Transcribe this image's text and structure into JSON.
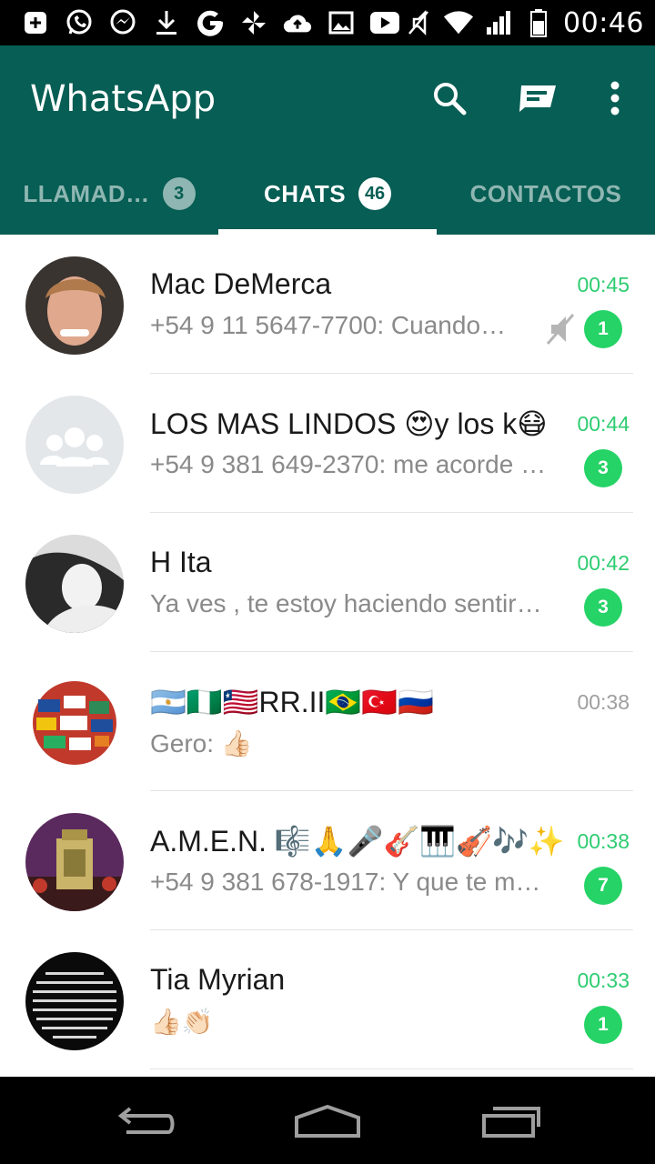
{
  "status_bar": {
    "time": "00:46",
    "left_icons": [
      "add-box-icon",
      "whatsapp-icon",
      "messenger-icon",
      "download-icon",
      "google-icon",
      "pinwheel-icon",
      "cloud-upload-icon",
      "image-icon",
      "youtube-icon"
    ],
    "right_icons": [
      "mute-icon",
      "wifi-icon",
      "signal-icon",
      "battery-icon"
    ]
  },
  "app_bar": {
    "title": "WhatsApp",
    "icons": [
      "search-icon",
      "new-chat-icon",
      "more-vert-icon"
    ]
  },
  "tabs": [
    {
      "label": "LLAMAD…",
      "count": "3",
      "active": false
    },
    {
      "label": "CHATS",
      "count": "46",
      "active": true
    },
    {
      "label": "CONTACTOS",
      "count": "",
      "active": false
    }
  ],
  "chats": [
    {
      "name": "Mac DeMerca",
      "time": "00:45",
      "preview": "+54 9 11 5647-7700: Cuando…",
      "unread": "1",
      "muted": true,
      "time_unread": true
    },
    {
      "name": "LOS MAS LINDOS 😍y los k😷",
      "time": "00:44",
      "preview": "+54 9 381 649-2370: me acorde j…",
      "unread": "3",
      "muted": false,
      "time_unread": true
    },
    {
      "name": "H Ita",
      "time": "00:42",
      "preview": "Ya ves , te estoy haciendo sentir…",
      "unread": "3",
      "muted": false,
      "time_unread": true
    },
    {
      "name": "🇦🇷🇳🇬🇱🇷RR.II🇧🇷🇹🇷🇷🇺",
      "time": "00:38",
      "preview": "Gero: 👍🏻",
      "unread": "",
      "muted": false,
      "time_unread": false
    },
    {
      "name": "A.M.E.N. 🎼🙏🎤🎸🎹🎻🎶✨",
      "time": "00:38",
      "preview": "+54 9 381 678-1917: Y que te me…",
      "unread": "7",
      "muted": false,
      "time_unread": true
    },
    {
      "name": "Tia Myrian",
      "time": "00:33",
      "preview": "👍🏻👏🏻",
      "unread": "1",
      "muted": false,
      "time_unread": true
    }
  ],
  "colors": {
    "primary": "#075e54",
    "unread_green": "#25d366",
    "time_green": "#2ecc71"
  },
  "nav_bar": {
    "icons": [
      "back-icon",
      "home-icon",
      "recents-icon"
    ]
  }
}
